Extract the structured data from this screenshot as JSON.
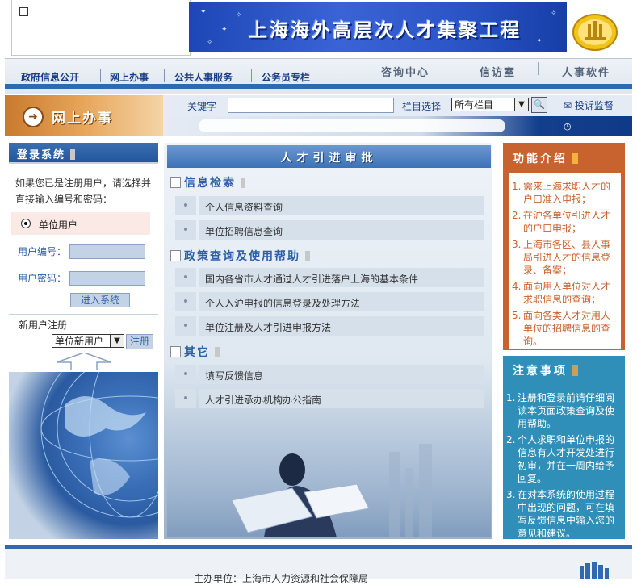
{
  "header": {
    "banner_title": "上海海外高层次人才集聚工程",
    "logo_icon": "emblem-icon"
  },
  "nav": {
    "left_items": [
      {
        "label": "政府信息公开"
      },
      {
        "label": "网上办事"
      },
      {
        "label": "公共人事服务"
      },
      {
        "label": "公务员专栏"
      }
    ],
    "right_items": [
      {
        "label": "咨询中心"
      },
      {
        "label": "信访室"
      },
      {
        "label": "人事软件"
      }
    ]
  },
  "section": {
    "label": "网上办事",
    "arrow_icon": "arrow-right-circle-icon"
  },
  "search": {
    "keyword_label": "关键字",
    "keyword_value": "",
    "column_label": "栏目选择",
    "column_selected": "所有栏目",
    "complaint_label": "投诉监督",
    "search_icon": "magnifier-icon",
    "envelope_icon": "envelope-icon",
    "clock_icon": "clock-icon"
  },
  "login": {
    "title": "登录系统",
    "description": "如果您已是注册用户，请选择并直接输入编号和密码：",
    "user_type": "单位用户",
    "user_id_label": "用户编号：",
    "user_id_value": "",
    "password_label": "用户密码：",
    "password_value": "",
    "enter_button": "进入系统",
    "new_user_label": "新用户注册",
    "new_user_selected": "单位新用户",
    "register_button": "注册"
  },
  "main": {
    "title": "人才引进审批",
    "categories": [
      {
        "title": "信息检索",
        "items": [
          "个人信息资料查询",
          "单位招聘信息查询"
        ]
      },
      {
        "title": "政策查询及使用帮助",
        "items": [
          "国内各省市人才通过人才引进落户上海的基本条件",
          "个人入沪申报的信息登录及处理方法",
          "单位注册及人才引进申报方法"
        ]
      },
      {
        "title": "其它",
        "items": [
          "填写反馈信息",
          "人才引进承办机构办公指南"
        ]
      }
    ]
  },
  "function_intro": {
    "title": "功能介绍",
    "items": [
      "需来上海求职人才的户口准入申报；",
      "在沪各单位引进人才的户口申报；",
      "上海市各区、县人事局引进人才的信息登录、备案；",
      "面向用人单位对人才求职信息的查询；",
      "面向各类人才对用人单位的招聘信息的查询。"
    ]
  },
  "notice": {
    "title": "注意事项",
    "items": [
      "注册和登录前请仔细阅读本页面政策查询及使用帮助。",
      "个人求职和单位申报的信息有人才开发处进行初审，并在一周内给予回复。",
      "在对本系统的使用过程中出现的问题，可在填写反馈信息中输入您的意见和建议。"
    ]
  },
  "footer": {
    "text": "主办单位：上海市人力资源和社会保障局"
  },
  "colors": {
    "nav_text": "#1a3f86",
    "blue_accent": "#2f6ab0",
    "orange_panel": "#c8622e",
    "teal_panel": "#2f8fb8"
  }
}
